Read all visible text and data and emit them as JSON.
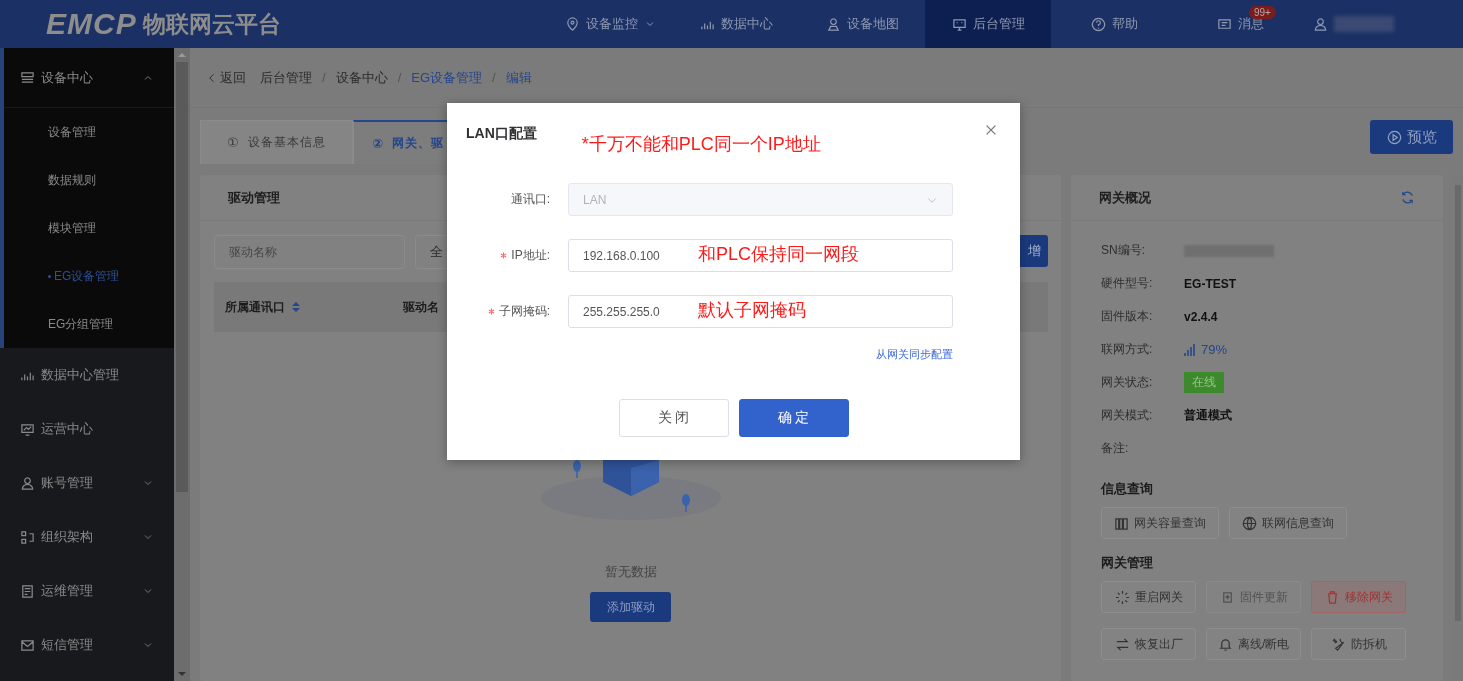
{
  "header": {
    "logo": {
      "mark": "EMCP",
      "name": "物联网云平台"
    },
    "nav": [
      {
        "label": "设备监控",
        "selected": false,
        "dropdown": true
      },
      {
        "label": "数据中心",
        "selected": false,
        "dropdown": false
      },
      {
        "label": "设备地图",
        "selected": false,
        "dropdown": false
      },
      {
        "label": "后台管理",
        "selected": true,
        "dropdown": false
      },
      {
        "label": "帮助",
        "selected": false,
        "dropdown": false
      },
      {
        "label": "消息",
        "selected": false,
        "dropdown": false,
        "badge": "99+"
      }
    ]
  },
  "sidebar": {
    "groups": [
      {
        "label": "设备中心",
        "kind": "group",
        "expanded": true,
        "children": [
          {
            "label": "设备管理",
            "selected": false
          },
          {
            "label": "数据规则",
            "selected": false
          },
          {
            "label": "模块管理",
            "selected": false
          },
          {
            "label": "EG设备管理",
            "selected": true
          },
          {
            "label": "EG分组管理",
            "selected": false
          }
        ]
      },
      {
        "label": "数据中心管理",
        "kind": "link"
      },
      {
        "label": "运营中心",
        "kind": "link"
      },
      {
        "label": "账号管理",
        "kind": "group",
        "expanded": false
      },
      {
        "label": "组织架构",
        "kind": "group",
        "expanded": false
      },
      {
        "label": "运维管理",
        "kind": "group",
        "expanded": false
      },
      {
        "label": "短信管理",
        "kind": "group",
        "expanded": false
      }
    ]
  },
  "breadcrumb": {
    "back": "返回",
    "separators": [
      "/",
      "/",
      "/"
    ],
    "items": [
      {
        "label": "后台管理",
        "highlighted": false
      },
      {
        "label": "设备中心",
        "highlighted": false
      },
      {
        "label": "EG设备管理",
        "highlighted": true
      },
      {
        "label": "编辑",
        "highlighted": true
      }
    ]
  },
  "tabs": [
    {
      "number": "①",
      "label": "设备基本信息",
      "selected": false
    },
    {
      "number": "②",
      "label": "网关、驱",
      "selected": true
    }
  ],
  "preview_button": "预览",
  "driver_card": {
    "title": "驱动管理",
    "search": {
      "placeholder": "驱动名称"
    },
    "select": "全",
    "add_button": "增",
    "columns": [
      "所属通讯口",
      "驱动名"
    ],
    "empty_text": "暂无数据",
    "add_driver_button": "添加驱动"
  },
  "gateway_card": {
    "title": "网关概况",
    "rows": [
      {
        "label": "SN编号:",
        "kind": "redacted"
      },
      {
        "label": "硬件型号:",
        "kind": "text",
        "value": "EG-TEST"
      },
      {
        "label": "固件版本:",
        "kind": "text",
        "value": "v2.4.4"
      },
      {
        "label": "联网方式:",
        "kind": "signal",
        "value": "79%"
      },
      {
        "label": "网关状态:",
        "kind": "tag",
        "value": "在线"
      },
      {
        "label": "网关模式:",
        "kind": "text",
        "value": "普通模式"
      },
      {
        "label": "备注:",
        "kind": "text"
      }
    ],
    "sections": [
      {
        "title": "信息查询",
        "buttons": [
          {
            "label": "网关容量查询",
            "kind": "normal"
          },
          {
            "label": "联网信息查询",
            "kind": "normal"
          }
        ]
      },
      {
        "title": "网关管理",
        "buttons": [
          {
            "label": "重启网关",
            "kind": "normal"
          },
          {
            "label": "固件更新",
            "kind": "disabled"
          },
          {
            "label": "移除网关",
            "kind": "danger"
          },
          {
            "label": "恢复出厂",
            "kind": "normal"
          },
          {
            "label": "离线/断电",
            "kind": "normal"
          },
          {
            "label": "防拆机",
            "kind": "normal"
          }
        ]
      }
    ]
  },
  "modal": {
    "title": "LAN口配置",
    "note": "*千万不能和PLC同一个IP地址",
    "fields": [
      {
        "label": "通讯口:",
        "kind": "select",
        "value": "LAN",
        "required": false,
        "disabled": true
      },
      {
        "label": "IP地址:",
        "kind": "input",
        "value": "192.168.0.100",
        "required": true,
        "disabled": false,
        "note": "和PLC保持同一网段"
      },
      {
        "label": "子网掩码:",
        "kind": "input",
        "value": "255.255.255.0",
        "required": true,
        "disabled": false,
        "note": "默认子网掩码"
      }
    ],
    "sync_link": "从网关同步配置",
    "buttons": [
      {
        "label": "关 闭",
        "kind": "default"
      },
      {
        "label": "确 定",
        "kind": "primary"
      }
    ]
  }
}
